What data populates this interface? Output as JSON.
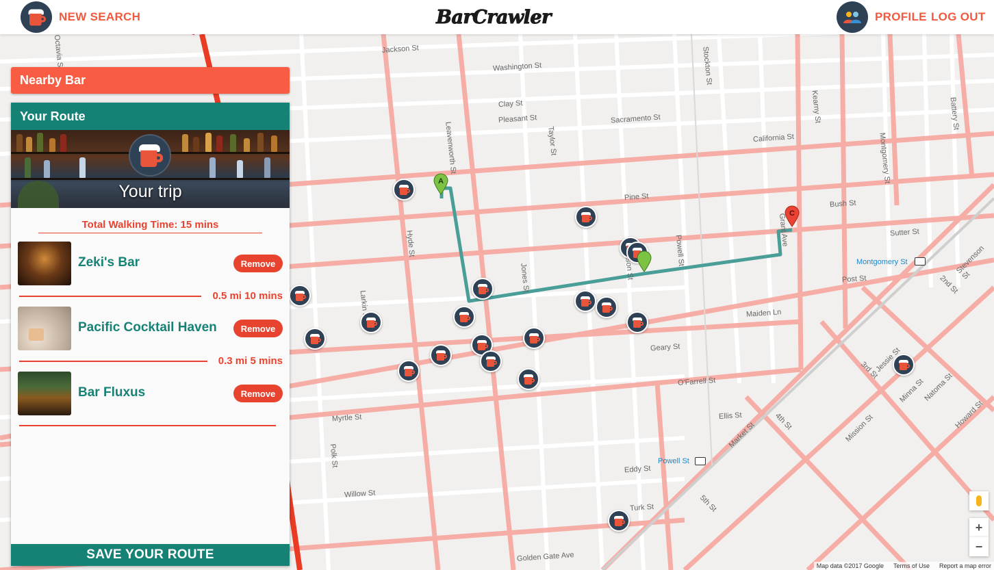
{
  "header": {
    "new_search_label": "NEW SEARCH",
    "logo_text": "BarCrawler",
    "profile_label": "PROFILE",
    "logout_label": "LOG OUT"
  },
  "panel": {
    "nearby_bar_label": "Nearby Bar",
    "your_route_label": "Your Route",
    "trip_title": "Your trip",
    "total_walking_time": "Total Walking Time: 15 mins",
    "stops": [
      {
        "name": "Zeki's Bar",
        "remove_label": "Remove"
      },
      {
        "name": "Pacific Cocktail Haven",
        "remove_label": "Remove"
      },
      {
        "name": "Bar Fluxus",
        "remove_label": "Remove"
      }
    ],
    "legs": [
      "0.5 mi 10 mins",
      "0.3 mi 5 mins"
    ],
    "save_label": "SAVE YOUR ROUTE"
  },
  "map": {
    "street_labels": [
      "Jackson St",
      "Washington St",
      "Clay St",
      "Pleasant St",
      "Sacramento St",
      "California St",
      "Pine St",
      "Bush St",
      "Sutter St",
      "Post St",
      "Geary St",
      "O'Farrell St",
      "Ellis St",
      "Eddy St",
      "Turk St",
      "Golden Gate Ave",
      "Myrtle St",
      "Willow St",
      "Maiden Ln",
      "Leavenworth St",
      "Hyde St",
      "Larkin St",
      "Polk St",
      "Jones St",
      "Taylor St",
      "Mason St",
      "Powell St",
      "Stockton St",
      "Grant Ave",
      "Kearny St",
      "Montgomery St",
      "Battery St",
      "Market St",
      "Mission St",
      "Howard St",
      "Minna St",
      "Natoma St",
      "Jessie St",
      "Stevenson St",
      "3rd St",
      "4th St",
      "5th St",
      "2nd St",
      "Octavia St"
    ],
    "transit_labels": [
      "Montgomery St",
      "Powell St"
    ],
    "pin_labels": [
      "A",
      "C"
    ],
    "attribution": [
      "Map data ©2017 Google",
      "Terms of Use",
      "Report a map error"
    ],
    "zoom_in": "+",
    "zoom_out": "−"
  },
  "colors": {
    "accent": "#f15a3e",
    "teal": "#168276",
    "marker": "#2e4155",
    "route": "#4a9e98"
  }
}
